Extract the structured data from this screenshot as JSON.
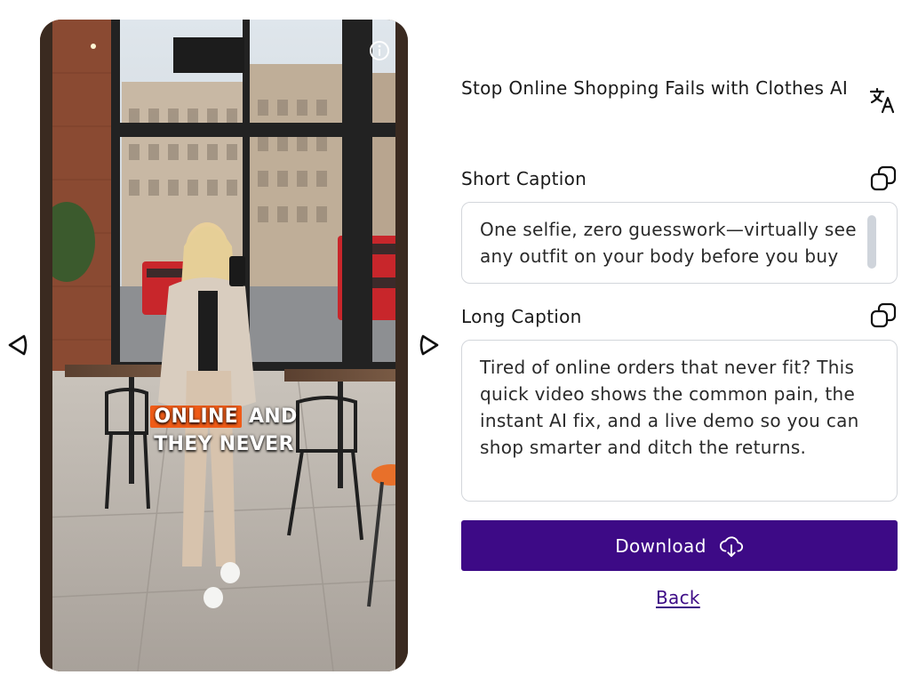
{
  "video": {
    "caption_line1_highlight": "ONLINE",
    "caption_line1_rest": " AND",
    "caption_line2": "THEY NEVER"
  },
  "panel": {
    "title": "Stop Online Shopping Fails with Clothes AI",
    "short_caption": {
      "label": "Short Caption",
      "text": "One selfie, zero guesswork—virtually see any outfit on your body before you buy"
    },
    "long_caption": {
      "label": "Long Caption",
      "text": "Tired of online orders that never fit? This quick video shows the common pain, the instant AI fix, and a live demo so you can shop smarter and ditch the returns."
    },
    "download_label": "Download",
    "back_label": "Back"
  },
  "colors": {
    "primary": "#3d0a86",
    "highlight": "#ef5b17"
  },
  "icons": [
    "info-icon",
    "chevron-left-icon",
    "chevron-right-icon",
    "translate-icon",
    "copy-icon",
    "cloud-download-icon"
  ]
}
